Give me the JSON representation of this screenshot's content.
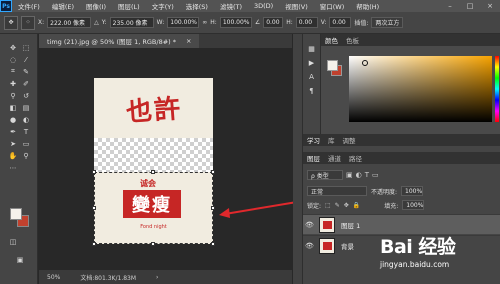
{
  "app": {
    "logo": "Ps"
  },
  "menu": [
    "文件(F)",
    "编辑(E)",
    "图像(I)",
    "图层(L)",
    "文字(Y)",
    "选择(S)",
    "滤镜(T)",
    "3D(D)",
    "视图(V)",
    "窗口(W)",
    "帮助(H)"
  ],
  "window_controls": [
    "–",
    "□",
    "×"
  ],
  "options_bar": {
    "x_label": "X:",
    "x_value": "222.00 像素",
    "y_label": "Y:",
    "y_value": "235.00 像素",
    "w_label": "W:",
    "w_value": "100.00%",
    "h_label": "H:",
    "h_value": "100.00%",
    "angle_value": "0.00",
    "h2_label": "H:",
    "h2_value": "0.00",
    "v_label": "V:",
    "v_value": "0.00",
    "interp_label": "插值:",
    "interp_value": "两次立方"
  },
  "document": {
    "tab_title": "timg (21).jpg @ 50% (图层 1, RGB/8#) *",
    "close": "×",
    "zoom": "50%",
    "doc_info": "文档:801.3K/1.83M",
    "poster_title": "也許",
    "poster_subtitle": "诚会",
    "poster_box_text": "變瘦",
    "poster_small": "Fond night"
  },
  "color_panel": {
    "tabs": [
      "颜色",
      "色板"
    ]
  },
  "learn_tabs": [
    "学习",
    "库",
    "调整"
  ],
  "layers_panel": {
    "tabs": [
      "图层",
      "通道",
      "路径"
    ],
    "blend_mode": "正常",
    "opacity_label": "不透明度:",
    "opacity_value": "100%",
    "lock_label": "锁定:",
    "fill_label": "填充:",
    "fill_value": "100%",
    "layers": [
      {
        "name": "图层 1",
        "selected": true
      },
      {
        "name": "背景",
        "selected": false
      }
    ]
  },
  "watermark": {
    "logo": "Bai 经验",
    "url": "jingyan.baidu.com"
  },
  "colors": {
    "accent_arrow": "#e0282c",
    "poster_red": "#c62625",
    "fg": "#f5f1eb",
    "bg": "#c0412e"
  }
}
